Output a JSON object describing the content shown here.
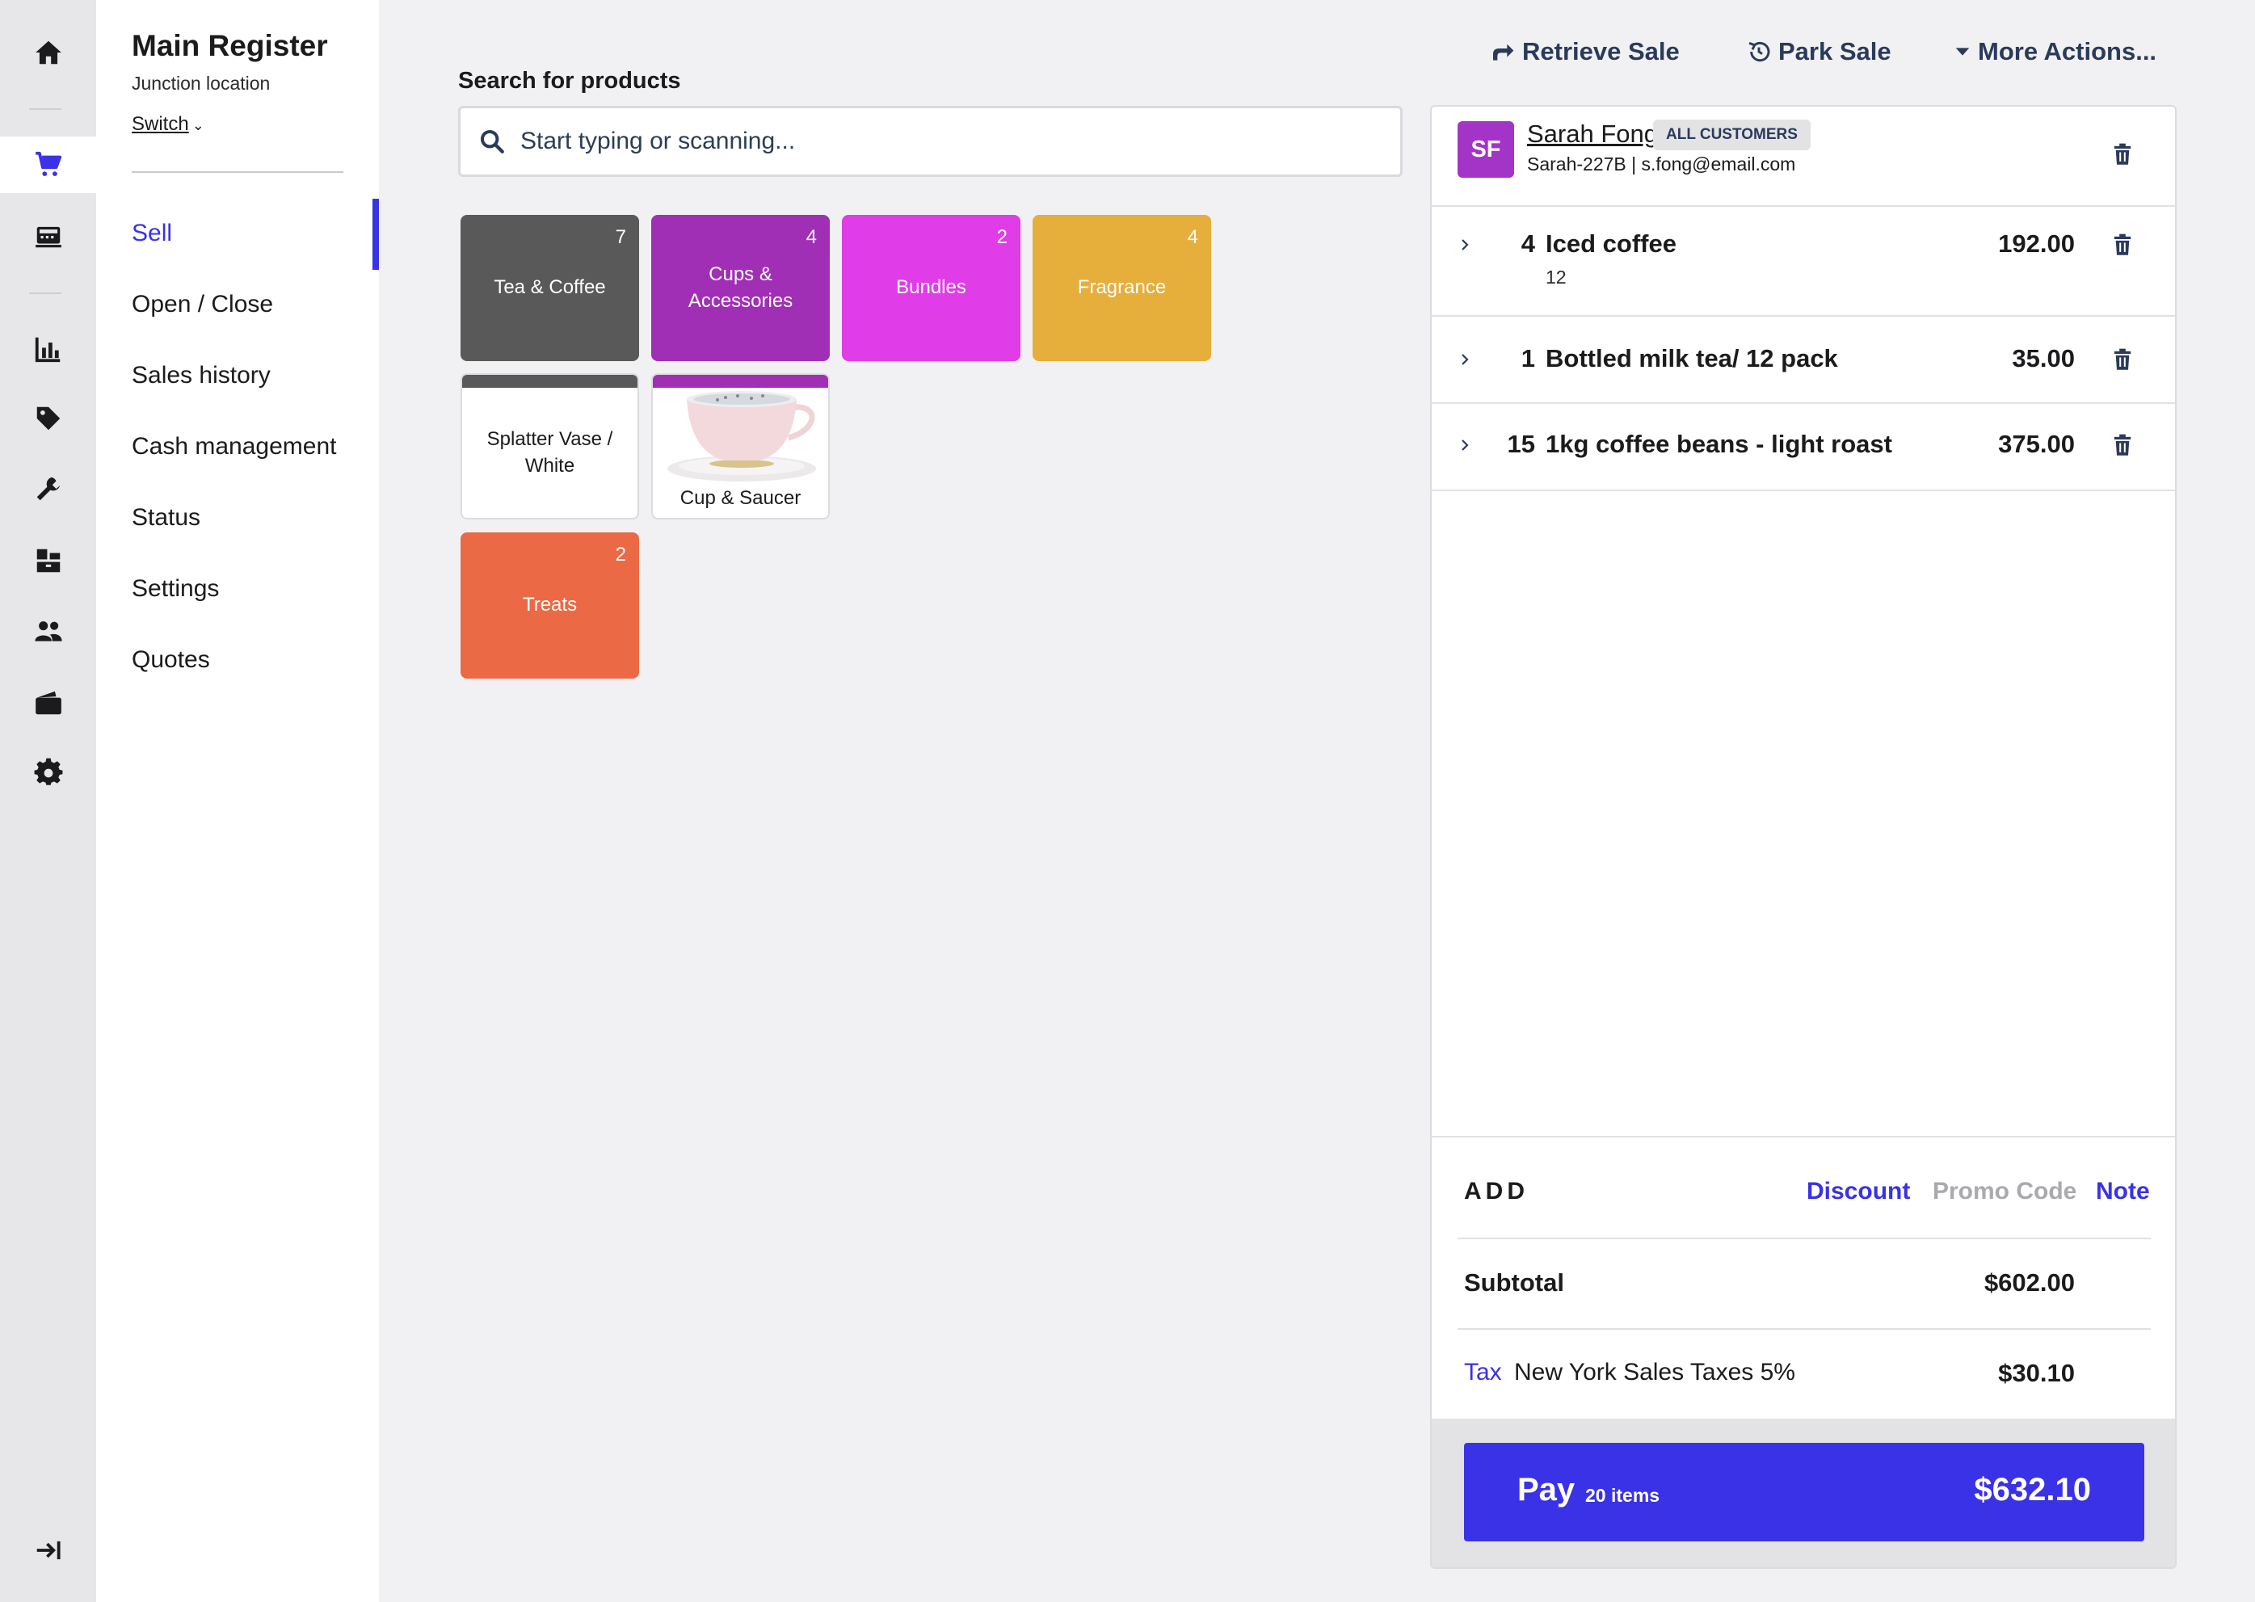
{
  "rail": {
    "icons": [
      "home-icon",
      "cart-icon",
      "register-icon",
      "reports-icon",
      "tag-icon",
      "wrench-icon",
      "inventory-icon",
      "customers-icon",
      "wallet-icon",
      "gear-icon",
      "collapse-icon"
    ]
  },
  "nav": {
    "title": "Main Register",
    "location": "Junction location",
    "switch_label": "Switch",
    "items": [
      "Sell",
      "Open / Close",
      "Sales history",
      "Cash management",
      "Status",
      "Settings",
      "Quotes"
    ],
    "active_item": "Sell"
  },
  "search": {
    "label": "Search for products",
    "placeholder": "Start typing or scanning..."
  },
  "tiles": [
    {
      "label": "Tea & Coffee",
      "count": "7",
      "color": "#595959"
    },
    {
      "label": "Cups & Accessories",
      "count": "4",
      "color": "#a02fb5"
    },
    {
      "label": "Bundles",
      "count": "2",
      "color": "#e03ce8"
    },
    {
      "label": "Fragrance",
      "count": "4",
      "color": "#e6ae3a"
    },
    {
      "label": "Splatter Vase / White",
      "count": "",
      "color": "#595959"
    },
    {
      "label": "Cup & Saucer",
      "count": "",
      "color": "#a02fb5"
    },
    {
      "label": "Treats",
      "count": "2",
      "color": "#eb6a45"
    }
  ],
  "header_actions": {
    "retrieve": "Retrieve Sale",
    "park": "Park Sale",
    "more": "More Actions..."
  },
  "customer": {
    "initials": "SF",
    "name": "Sarah Fong",
    "badge": "ALL CUSTOMERS",
    "meta": "Sarah-227B | s.fong@email.com"
  },
  "line_items": [
    {
      "qty": "4",
      "name": "Iced coffee",
      "sub": "12",
      "price": "192.00"
    },
    {
      "qty": "1",
      "name": "Bottled milk tea/ 12 pack",
      "sub": "",
      "price": "35.00"
    },
    {
      "qty": "15",
      "name": "1kg coffee beans - light roast",
      "sub": "",
      "price": "375.00"
    }
  ],
  "totals": {
    "add_label": "ADD",
    "discount": "Discount",
    "promo": "Promo Code",
    "note": "Note",
    "subtotal_label": "Subtotal",
    "subtotal": "$602.00",
    "tax_label": "Tax",
    "tax_desc": "New York Sales Taxes 5%",
    "tax": "$30.10"
  },
  "pay": {
    "label": "Pay",
    "items": "20 items",
    "amount": "$632.10"
  },
  "colors": {
    "accent": "#3a32e6",
    "muted_link": "#a9a9ae"
  }
}
